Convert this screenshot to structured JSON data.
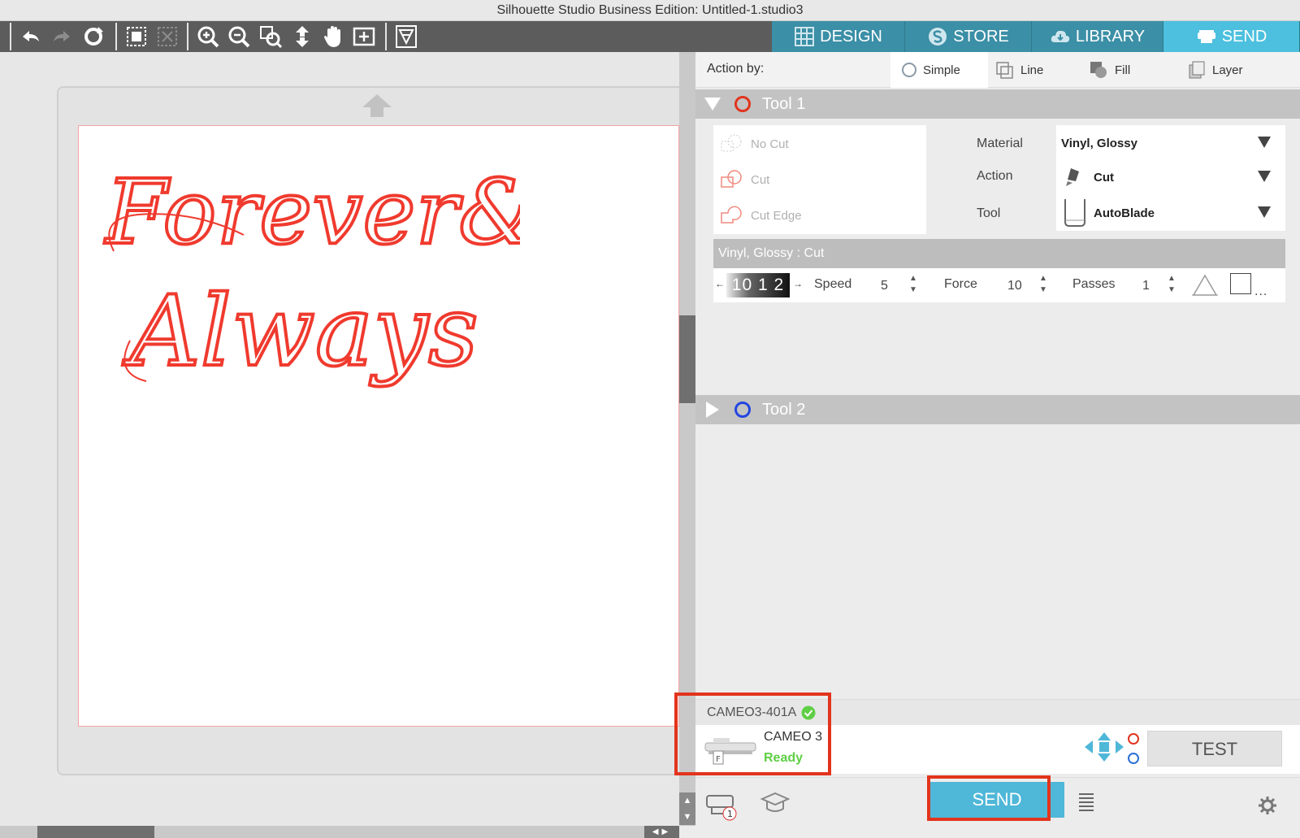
{
  "window": {
    "title": "Silhouette Studio Business Edition: Untitled-1.studio3"
  },
  "toolbar": {
    "icons": [
      "undo-icon",
      "redo-icon",
      "redraw-icon",
      "select-all-icon",
      "deselect-icon",
      "zoom-in-icon",
      "zoom-out-icon",
      "zoom-fit-icon",
      "pan-down-icon",
      "pan-hand-icon",
      "fit-page-icon",
      "trace-icon"
    ]
  },
  "tabs": [
    {
      "label": "DESIGN",
      "icon": "grid-icon",
      "active": false
    },
    {
      "label": "STORE",
      "icon": "store-s-icon",
      "active": false
    },
    {
      "label": "LIBRARY",
      "icon": "cloud-icon",
      "active": false
    },
    {
      "label": "SEND",
      "icon": "cutter-icon",
      "active": true
    }
  ],
  "panel": {
    "action_by_label": "Action by:",
    "action_options": [
      {
        "label": "Simple",
        "icon": "radio-icon",
        "selected": true
      },
      {
        "label": "Line",
        "icon": "line-icon",
        "selected": false
      },
      {
        "label": "Fill",
        "icon": "fill-icon",
        "selected": false
      },
      {
        "label": "Layer",
        "icon": "layer-icon",
        "selected": false
      }
    ],
    "tool1": {
      "label": "Tool 1",
      "ring_color": "#e2341d",
      "cut_options": [
        "No Cut",
        "Cut",
        "Cut Edge"
      ],
      "material_label": "Material",
      "material_value": "Vinyl, Glossy",
      "action_label": "Action",
      "action_value": "Cut",
      "tool_label": "Tool",
      "tool_value": "AutoBlade",
      "summary": "Vinyl, Glossy : Cut",
      "blade_depth": "10 1 2",
      "speed_label": "Speed",
      "speed_value": "5",
      "force_label": "Force",
      "force_value": "10",
      "passes_label": "Passes",
      "passes_value": "1"
    },
    "tool2": {
      "label": "Tool 2",
      "ring_color": "#2345e0"
    },
    "device": {
      "name": "CAMEO3-401A",
      "model": "CAMEO 3",
      "status": "Ready",
      "status_color": "#5fcf45"
    },
    "test_label": "TEST",
    "send_label": "SEND"
  },
  "canvas": {
    "artwork_text_line1": "Forever&",
    "artwork_text_line2": "Always",
    "artwork_color": "#f03a2e"
  }
}
